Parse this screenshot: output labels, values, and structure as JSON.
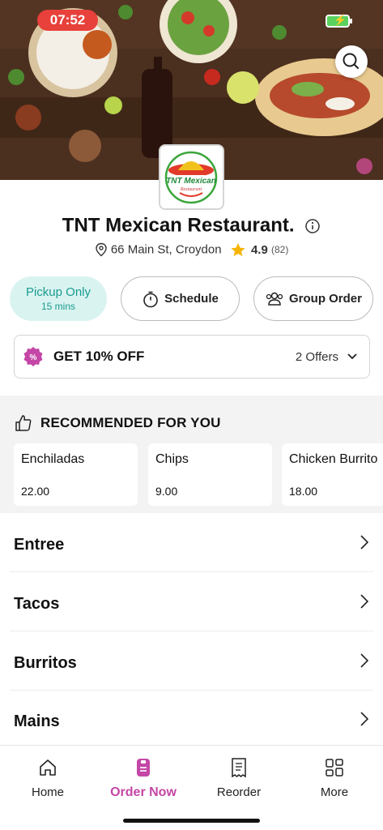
{
  "status_bar": {
    "time": "07:52"
  },
  "restaurant": {
    "name": "TNT Mexican Restaurant.",
    "address": "66 Main St, Croydon",
    "rating": "4.9",
    "reviews": "(82)",
    "logo_text": "TNT Mexican",
    "logo_subtext": "Restaurant"
  },
  "actions": {
    "pickup_label": "Pickup Only",
    "pickup_time": "15 mins",
    "schedule_label": "Schedule",
    "group_order_label": "Group Order"
  },
  "offer": {
    "text": "GET 10% OFF",
    "count": "2 Offers"
  },
  "recommended": {
    "title": "RECOMMENDED FOR YOU",
    "items": [
      {
        "name": "Enchiladas",
        "price": "22.00"
      },
      {
        "name": "Chips",
        "price": "9.00"
      },
      {
        "name": "Chicken Burrito",
        "price": "18.00"
      }
    ]
  },
  "categories": [
    "Entree",
    "Tacos",
    "Burritos",
    "Mains"
  ],
  "nav": {
    "items": [
      {
        "label": "Home",
        "icon": "home-icon"
      },
      {
        "label": "Order Now",
        "icon": "order-icon",
        "active": true
      },
      {
        "label": "Reorder",
        "icon": "receipt-icon"
      },
      {
        "label": "More",
        "icon": "grid-icon"
      }
    ]
  },
  "colors": {
    "accent": "#c446a6",
    "pickup_bg": "#d9f3f1",
    "pickup_text": "#1a9c8f",
    "time_pill": "#e8403a",
    "star": "#f5b400"
  }
}
